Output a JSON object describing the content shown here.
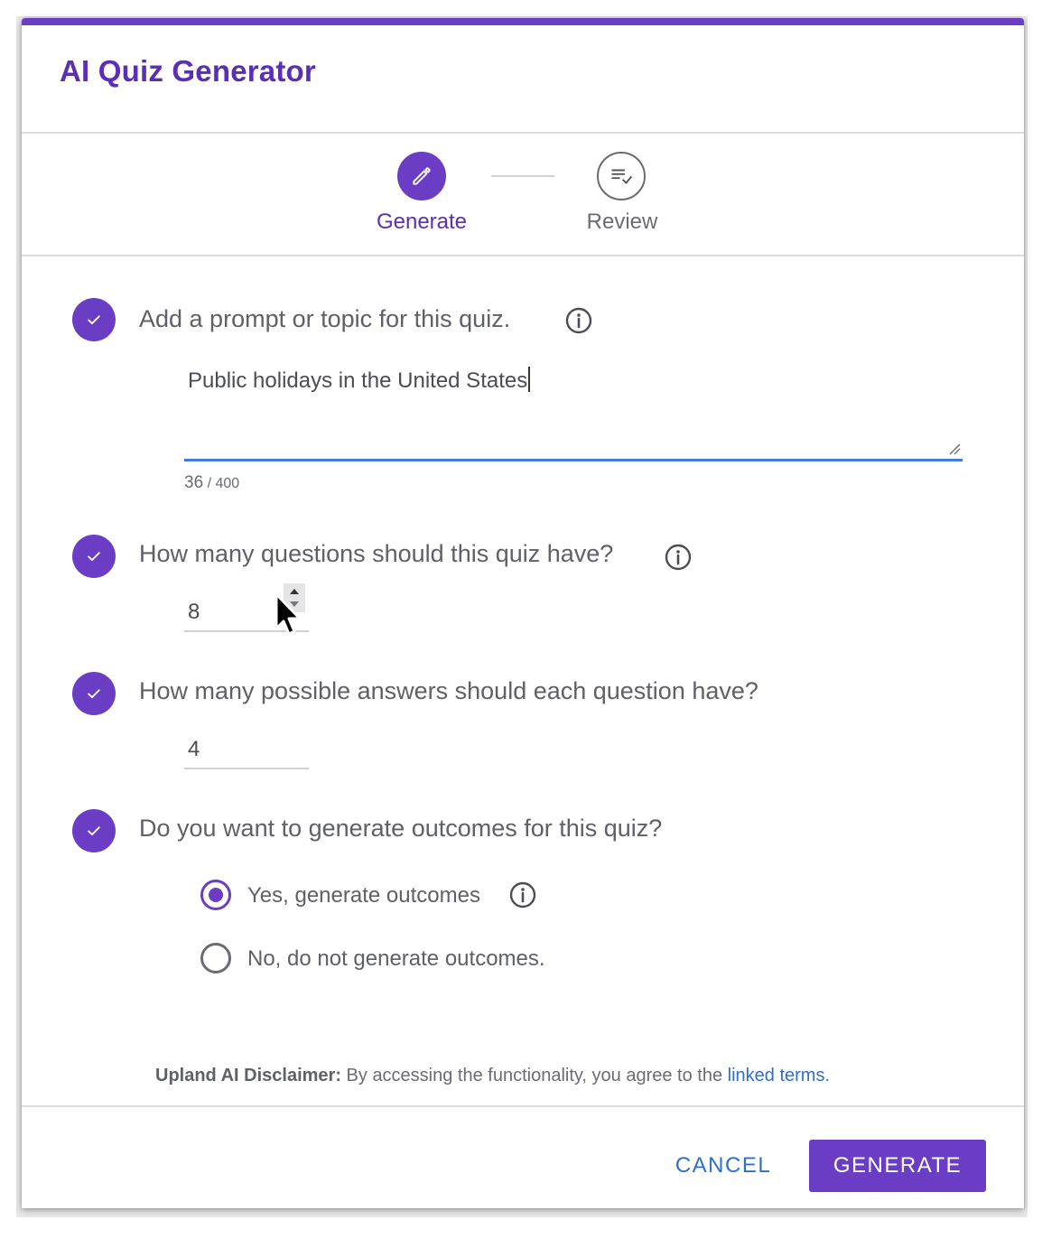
{
  "dialog": {
    "title": "AI Quiz Generator"
  },
  "stepper": {
    "steps": [
      {
        "label": "Generate",
        "state": "active",
        "icon": "pencil-icon"
      },
      {
        "label": "Review",
        "state": "inactive",
        "icon": "list-check-icon"
      }
    ]
  },
  "form": {
    "prompt": {
      "question": "Add a prompt or topic for this quiz.",
      "value": "Public holidays in the United States",
      "count": "36",
      "max": " / 400"
    },
    "questions": {
      "question": "How many questions should this quiz have?",
      "value": "8"
    },
    "answers": {
      "question": "How many possible answers should each question have?",
      "value": "4"
    },
    "outcomes": {
      "question": "Do you want to generate outcomes for this quiz?",
      "options": [
        {
          "label": "Yes, generate outcomes",
          "selected": true
        },
        {
          "label": "No, do not generate outcomes.",
          "selected": false
        }
      ]
    }
  },
  "disclaimer": {
    "bold": "Upland AI Disclaimer:",
    "text": " By accessing the functionality, you agree to the ",
    "link": "linked terms",
    "end": "."
  },
  "footer": {
    "cancel_label": "CANCEL",
    "generate_label": "GENERATE"
  },
  "colors": {
    "accent": "#6a3dc4",
    "link": "#2e6fcf",
    "focus_underline": "#3f7be0"
  }
}
